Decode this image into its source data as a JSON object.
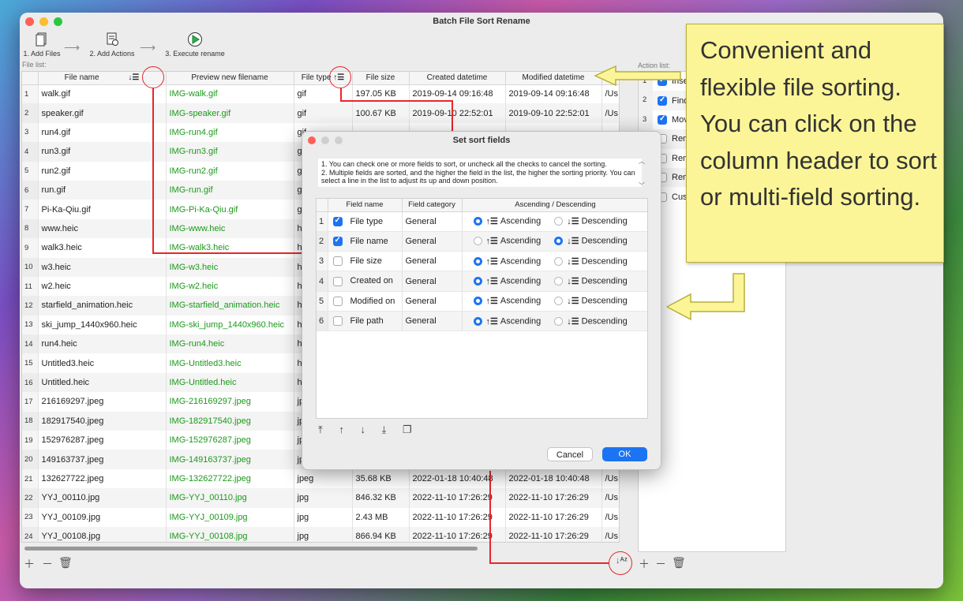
{
  "window": {
    "title": "Batch File Sort Rename"
  },
  "toolbar": {
    "step1": "1. Add Files",
    "step2": "2. Add Actions",
    "step3": "3. Execute rename"
  },
  "file_list": {
    "label": "File list:",
    "columns": [
      "File name",
      "Preview new filename",
      "File type",
      "File size",
      "Created datetime",
      "Modified datetime"
    ],
    "rows": [
      {
        "n": "1",
        "name": "walk.gif",
        "preview": "IMG-walk.gif",
        "type": "gif",
        "size": "197.05 KB",
        "created": "2019-09-14 09:16:48",
        "modified": "2019-09-14 09:16:48",
        "path": "/Us"
      },
      {
        "n": "2",
        "name": "speaker.gif",
        "preview": "IMG-speaker.gif",
        "type": "gif",
        "size": "100.67 KB",
        "created": "2019-09-10 22:52:01",
        "modified": "2019-09-10 22:52:01",
        "path": "/Us"
      },
      {
        "n": "3",
        "name": "run4.gif",
        "preview": "IMG-run4.gif",
        "type": "gif",
        "size": "",
        "created": "",
        "modified": "",
        "path": ""
      },
      {
        "n": "4",
        "name": "run3.gif",
        "preview": "IMG-run3.gif",
        "type": "g",
        "size": "",
        "created": "",
        "modified": "",
        "path": ""
      },
      {
        "n": "5",
        "name": "run2.gif",
        "preview": "IMG-run2.gif",
        "type": "g",
        "size": "",
        "created": "",
        "modified": "",
        "path": ""
      },
      {
        "n": "6",
        "name": "run.gif",
        "preview": "IMG-run.gif",
        "type": "g",
        "size": "",
        "created": "",
        "modified": "",
        "path": ""
      },
      {
        "n": "7",
        "name": "Pi-Ka-Qiu.gif",
        "preview": "IMG-Pi-Ka-Qiu.gif",
        "type": "g",
        "size": "",
        "created": "",
        "modified": "",
        "path": ""
      },
      {
        "n": "8",
        "name": "www.heic",
        "preview": "IMG-www.heic",
        "type": "h",
        "size": "",
        "created": "",
        "modified": "",
        "path": ""
      },
      {
        "n": "9",
        "name": "walk3.heic",
        "preview": "IMG-walk3.heic",
        "type": "h",
        "size": "",
        "created": "",
        "modified": "",
        "path": ""
      },
      {
        "n": "10",
        "name": "w3.heic",
        "preview": "IMG-w3.heic",
        "type": "h",
        "size": "",
        "created": "",
        "modified": "",
        "path": ""
      },
      {
        "n": "11",
        "name": "w2.heic",
        "preview": "IMG-w2.heic",
        "type": "h",
        "size": "",
        "created": "",
        "modified": "",
        "path": ""
      },
      {
        "n": "12",
        "name": "starfield_animation.heic",
        "preview": "IMG-starfield_animation.heic",
        "type": "h",
        "size": "",
        "created": "",
        "modified": "",
        "path": ""
      },
      {
        "n": "13",
        "name": "ski_jump_1440x960.heic",
        "preview": "IMG-ski_jump_1440x960.heic",
        "type": "h",
        "size": "",
        "created": "",
        "modified": "",
        "path": ""
      },
      {
        "n": "14",
        "name": "run4.heic",
        "preview": "IMG-run4.heic",
        "type": "h",
        "size": "",
        "created": "",
        "modified": "",
        "path": ""
      },
      {
        "n": "15",
        "name": "Untitled3.heic",
        "preview": "IMG-Untitled3.heic",
        "type": "h",
        "size": "",
        "created": "",
        "modified": "",
        "path": ""
      },
      {
        "n": "16",
        "name": "Untitled.heic",
        "preview": "IMG-Untitled.heic",
        "type": "h",
        "size": "",
        "created": "",
        "modified": "",
        "path": ""
      },
      {
        "n": "17",
        "name": "216169297.jpeg",
        "preview": "IMG-216169297.jpeg",
        "type": "jp",
        "size": "",
        "created": "",
        "modified": "",
        "path": ""
      },
      {
        "n": "18",
        "name": "182917540.jpeg",
        "preview": "IMG-182917540.jpeg",
        "type": "jp",
        "size": "",
        "created": "",
        "modified": "",
        "path": ""
      },
      {
        "n": "19",
        "name": "152976287.jpeg",
        "preview": "IMG-152976287.jpeg",
        "type": "jp",
        "size": "",
        "created": "",
        "modified": "",
        "path": ""
      },
      {
        "n": "20",
        "name": "149163737.jpeg",
        "preview": "IMG-149163737.jpeg",
        "type": "jp",
        "size": "",
        "created": "",
        "modified": "",
        "path": ""
      },
      {
        "n": "21",
        "name": "132627722.jpeg",
        "preview": "IMG-132627722.jpeg",
        "type": "jpeg",
        "size": "35.68 KB",
        "created": "2022-01-18 10:40:48",
        "modified": "2022-01-18 10:40:48",
        "path": "/Us"
      },
      {
        "n": "22",
        "name": "YYJ_00110.jpg",
        "preview": "IMG-YYJ_00110.jpg",
        "type": "jpg",
        "size": "846.32 KB",
        "created": "2022-11-10 17:26:29",
        "modified": "2022-11-10 17:26:29",
        "path": "/Us"
      },
      {
        "n": "23",
        "name": "YYJ_00109.jpg",
        "preview": "IMG-YYJ_00109.jpg",
        "type": "jpg",
        "size": "2.43 MB",
        "created": "2022-11-10 17:26:29",
        "modified": "2022-11-10 17:26:29",
        "path": "/Us"
      },
      {
        "n": "24",
        "name": "YYJ_00108.jpg",
        "preview": "IMG-YYJ_00108.jpg",
        "type": "jpg",
        "size": "866.94 KB",
        "created": "2022-11-10 17:26:29",
        "modified": "2022-11-10 17:26:29",
        "path": "/Us"
      }
    ]
  },
  "action_list": {
    "label": "Action list:",
    "items": [
      {
        "n": "1",
        "label": "Inser",
        "checked": true
      },
      {
        "n": "2",
        "label": "Find",
        "checked": true
      },
      {
        "n": "3",
        "label": "Move",
        "checked": true
      },
      {
        "n": "4",
        "label": "Remo",
        "checked": false
      },
      {
        "n": "5",
        "label": "Remo",
        "checked": false
      },
      {
        "n": "6",
        "label": "Remo",
        "checked": false
      },
      {
        "n": "7",
        "label": "Cust",
        "checked": false
      }
    ]
  },
  "sort_dialog": {
    "title": "Set sort fields",
    "help_line1": "1. You can check one or more fields to sort, or uncheck all the checks to cancel the sorting.",
    "help_line2": "2. Multiple fields are sorted, and the higher the field in the list, the higher the sorting priority. You can select a line in the list to adjust its up and down position.",
    "columns": [
      "Field name",
      "Field category",
      "Ascending / Descending"
    ],
    "ascending_label": "Ascending",
    "descending_label": "Descending",
    "rows": [
      {
        "n": "1",
        "field": "File type",
        "category": "General",
        "checked": true,
        "order": "asc"
      },
      {
        "n": "2",
        "field": "File name",
        "category": "General",
        "checked": true,
        "order": "desc"
      },
      {
        "n": "3",
        "field": "File size",
        "category": "General",
        "checked": false,
        "order": "asc"
      },
      {
        "n": "4",
        "field": "Created on",
        "category": "General",
        "checked": false,
        "order": "asc"
      },
      {
        "n": "5",
        "field": "Modified on",
        "category": "General",
        "checked": false,
        "order": "asc"
      },
      {
        "n": "6",
        "field": "File path",
        "category": "General",
        "checked": false,
        "order": "asc"
      }
    ],
    "cancel_label": "Cancel",
    "ok_label": "OK"
  },
  "callout": {
    "text": "Convenient and flexible file sorting. You can click on the column header to sort or multi-field sorting."
  },
  "colors": {
    "accent": "#1c74f2",
    "preview_text": "#1a9a1a",
    "highlight_red": "#e8262b",
    "callout_bg": "#fbf597"
  }
}
